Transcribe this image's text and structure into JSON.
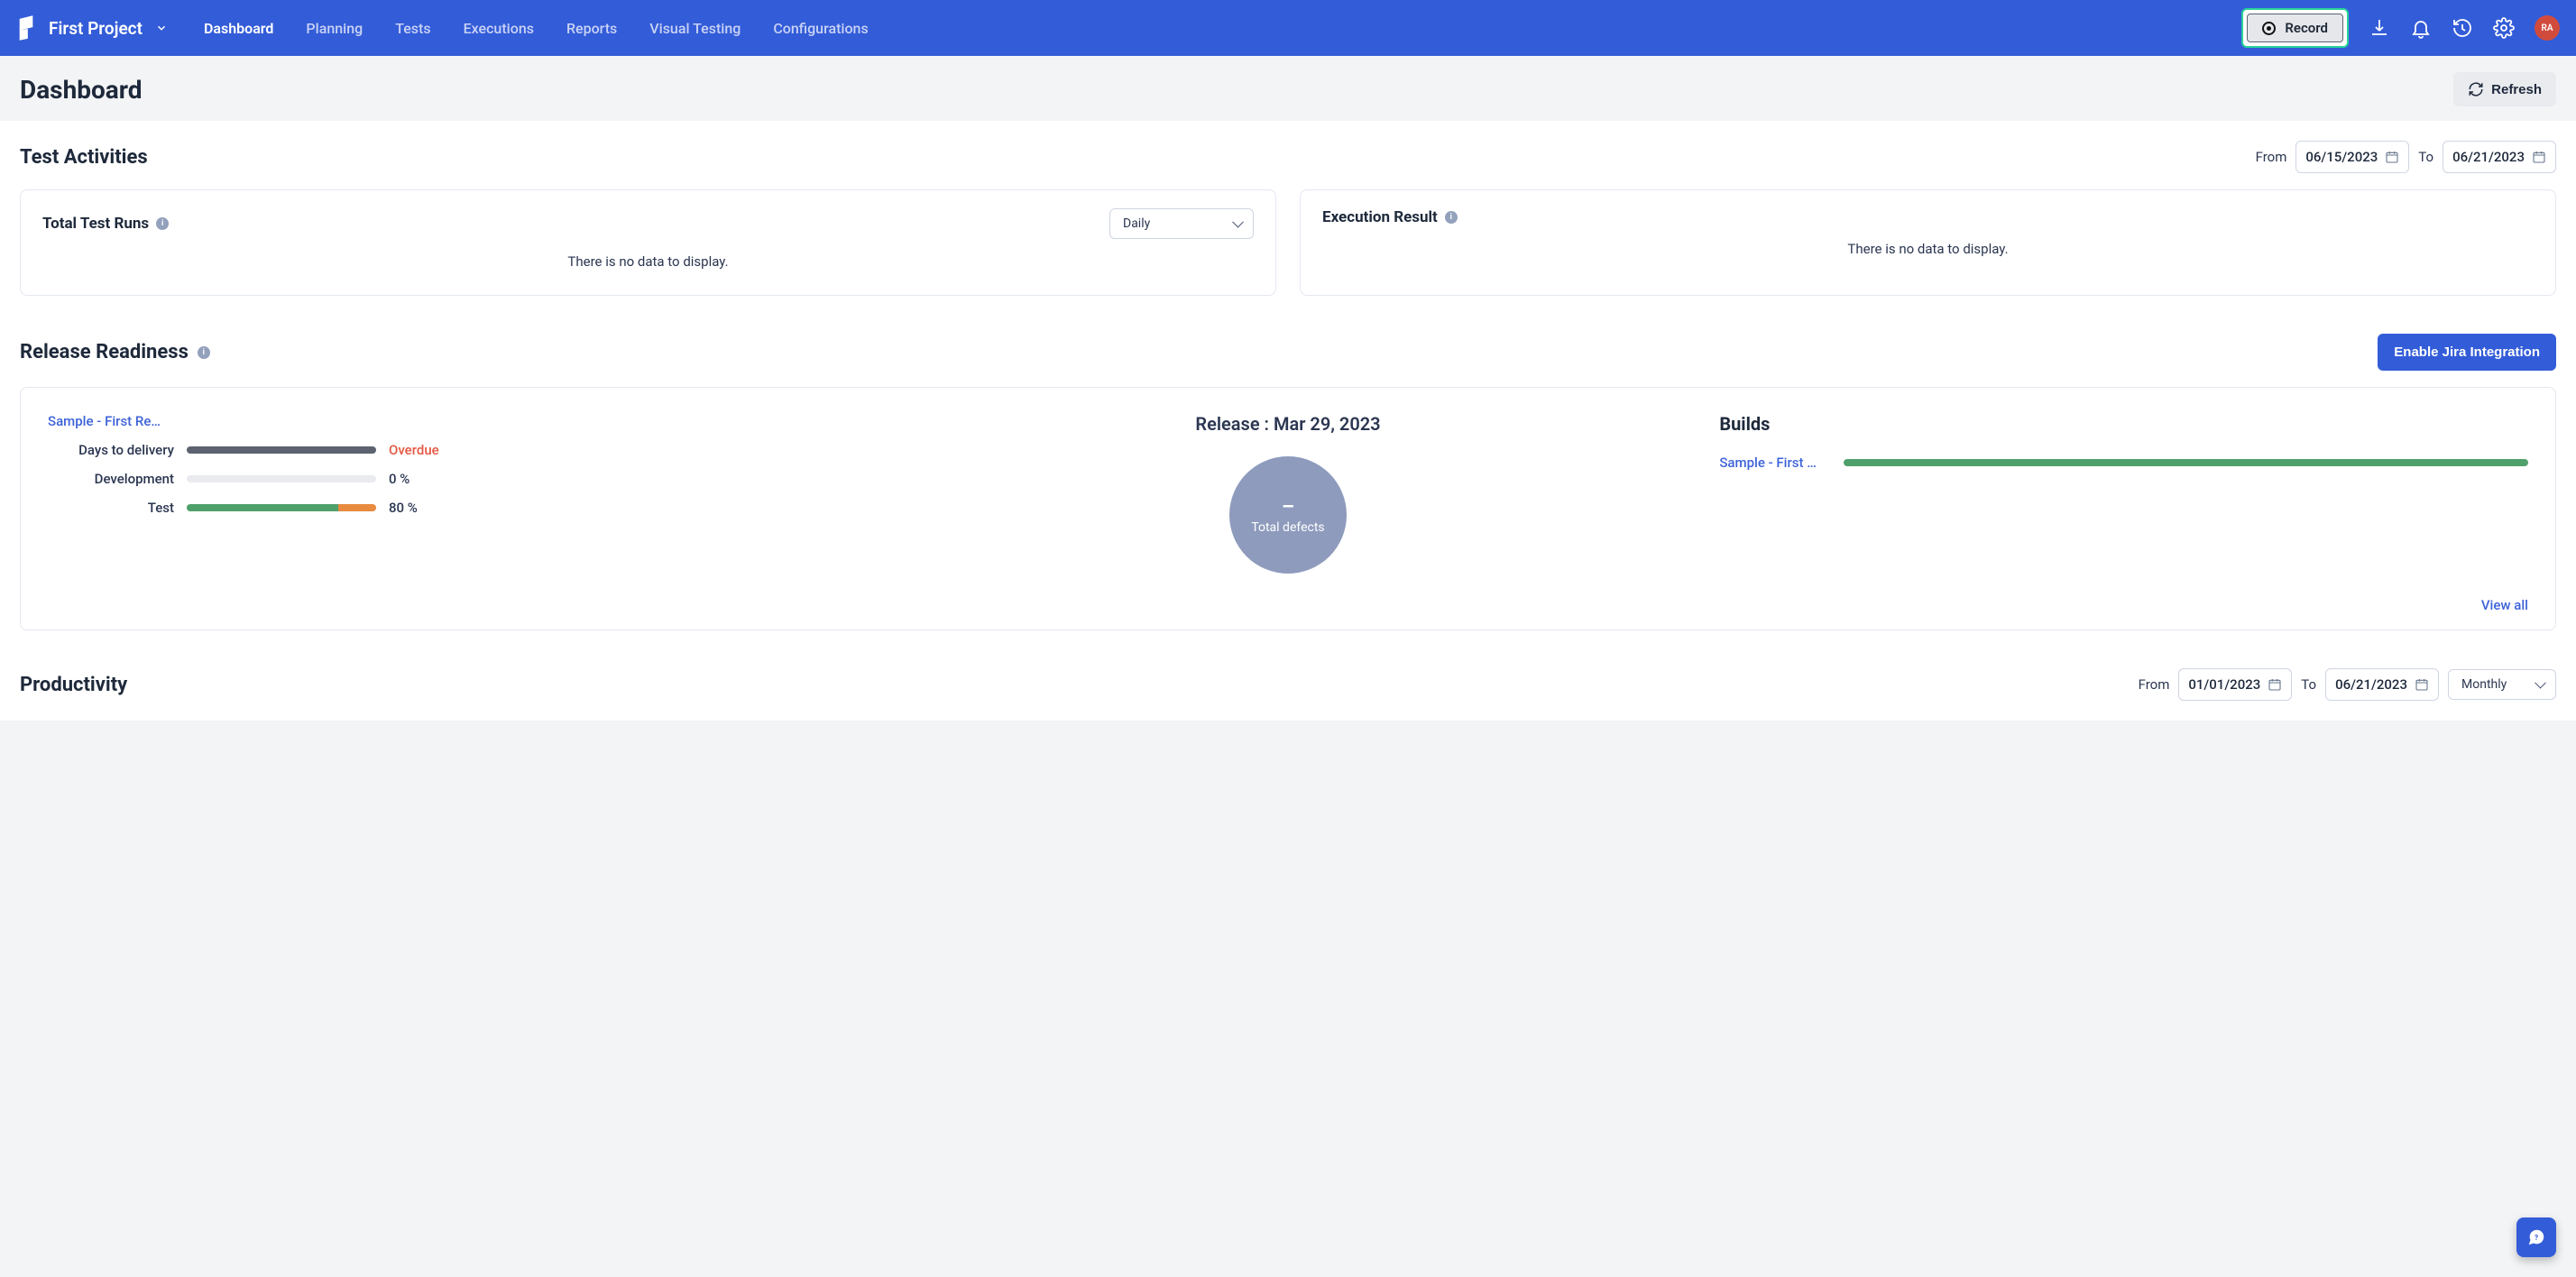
{
  "topnav": {
    "project_name": "First Project",
    "links": [
      "Dashboard",
      "Planning",
      "Tests",
      "Executions",
      "Reports",
      "Visual Testing",
      "Configurations"
    ],
    "active_index": 0,
    "record_label": "Record",
    "avatar_initials": "RA"
  },
  "page": {
    "title": "Dashboard",
    "refresh_label": "Refresh"
  },
  "test_activities": {
    "title": "Test Activities",
    "from_label": "From",
    "to_label": "To",
    "from_date": "06/15/2023",
    "to_date": "06/21/2023",
    "card_runs": {
      "title": "Total Test Runs",
      "select_value": "Daily",
      "no_data": "There is no data to display."
    },
    "card_exec": {
      "title": "Execution Result",
      "no_data": "There is no data to display."
    }
  },
  "release_readiness": {
    "title": "Release Readiness",
    "jira_btn": "Enable Jira Integration",
    "sample_link": "Sample - First Re…",
    "metrics": {
      "days_delivery": {
        "label": "Days to delivery",
        "percent_gray": 100,
        "value": "Overdue",
        "overdue": true
      },
      "development": {
        "label": "Development",
        "percent_gray": 0,
        "value": "0 %"
      },
      "test": {
        "label": "Test",
        "percent_green": 80,
        "percent_orange": 20,
        "value": "80 %"
      }
    },
    "release_title": "Release : Mar 29, 2023",
    "defects": {
      "value": "–",
      "label": "Total defects"
    },
    "builds": {
      "title": "Builds",
      "item_link": "Sample - First …",
      "item_percent": 100
    },
    "view_all": "View all"
  },
  "productivity": {
    "title": "Productivity",
    "from_label": "From",
    "to_label": "To",
    "from_date": "01/01/2023",
    "to_date": "06/21/2023",
    "interval": "Monthly"
  },
  "colors": {
    "gray_bar": "#5c6270",
    "green_bar": "#4fa06b",
    "orange_bar": "#e88a3f"
  },
  "chart_data": [
    {
      "type": "bar",
      "title": "Release Readiness Metrics",
      "categories": [
        "Days to delivery",
        "Development",
        "Test"
      ],
      "series": [
        {
          "name": "progress_pct",
          "values": [
            100,
            0,
            80
          ]
        }
      ],
      "annotations": {
        "Days to delivery": "Overdue",
        "Test_remainder_pct": 20
      },
      "xlabel": "",
      "ylabel": "%",
      "ylim": [
        0,
        100
      ]
    },
    {
      "type": "pie",
      "title": "Total defects",
      "categories": [
        "Total defects"
      ],
      "values": [
        0
      ]
    },
    {
      "type": "bar",
      "title": "Builds",
      "categories": [
        "Sample - First …"
      ],
      "values": [
        100
      ],
      "ylim": [
        0,
        100
      ]
    }
  ]
}
